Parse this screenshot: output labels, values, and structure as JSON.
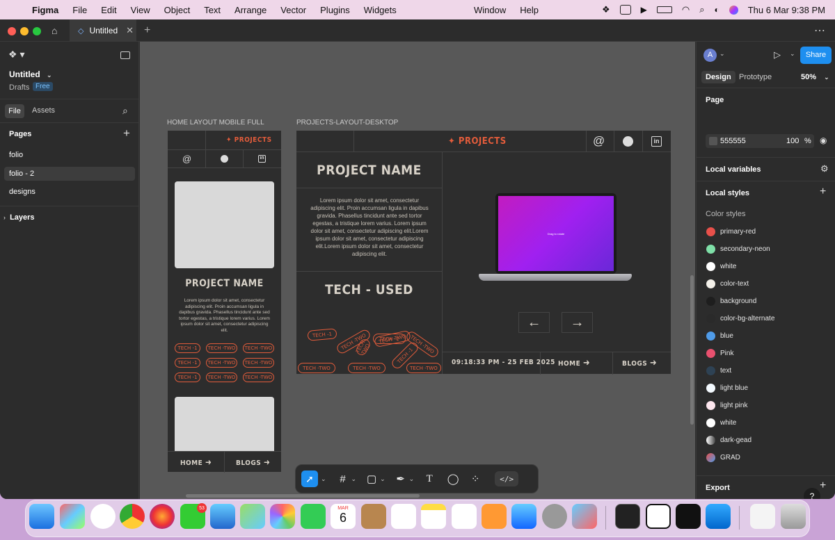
{
  "menubar": {
    "app_name": "Figma",
    "items": [
      "File",
      "Edit",
      "View",
      "Object",
      "Text",
      "Arrange",
      "Vector",
      "Plugins",
      "Widgets"
    ],
    "center_items": [
      "Window",
      "Help"
    ],
    "datetime": "Thu 6 Mar  9:38 PM"
  },
  "tab": {
    "title": "Untitled"
  },
  "left_panel": {
    "file_name": "Untitled",
    "location": "Drafts",
    "plan_badge": "Free",
    "tabs": [
      "File",
      "Assets"
    ],
    "pages_header": "Pages",
    "pages": [
      "folio",
      "folio - 2",
      "designs"
    ],
    "layers_header": "Layers"
  },
  "canvas": {
    "mobile_label": "HOME LAYOUT MOBILE FULL",
    "desktop_label": "PROJECTS-LAYOUT-DESKTOP",
    "projects_nav": "✦ PROJECTS",
    "project_name": "PROJECT NAME",
    "tech_used": "TECH - USED",
    "lorem_mobile": "Lorem ipsum dolor sit amet, consectetur adipiscing elit.  Proin accumsan ligula in dapibus gravida. Phasellus tincidunt ante sed tortor egestas, a tristique lorem varius. Lorem ipsum dolor sit amet, consectetur adipiscing elit.",
    "lorem_desktop": "Lorem ipsum dolor sit amet, consectetur adipiscing elit.  Proin accumsan ligula in dapibus gravida. Phasellus tincidunt ante sed tortor egestas, a tristique lorem varius. Lorem ipsum dolor sit amet, consectetur adipiscing elit.Lorem ipsum dolor sit amet, consectetur adipiscing elit.Lorem ipsum dolor sit amet, consectetur adipiscing elit.",
    "pill_one": "TECH -1",
    "pill_two": "TECH -TWO",
    "datetime_bar": "09:18:33 PM - 25 FEB 2025",
    "home_btn": "HOME",
    "blogs_btn": "BLOGS",
    "laptop_screen_text": "Drag to rotate",
    "at_symbol": "@",
    "linkedin_text": "in"
  },
  "right_panel": {
    "avatar": "A",
    "share": "Share",
    "tabs": [
      "Design",
      "Prototype"
    ],
    "zoom": "50%",
    "page_header": "Page",
    "page_color": "555555",
    "page_opacity": "100",
    "percent_sign": "%",
    "local_variables": "Local variables",
    "local_styles": "Local styles",
    "color_styles_header": "Color styles",
    "color_styles": [
      {
        "name": "primary-red",
        "color": "#e8504a"
      },
      {
        "name": "secondary-neon",
        "color": "#7fe0a8"
      },
      {
        "name": "white",
        "color": "#ffffff"
      },
      {
        "name": "color-text",
        "color": "#f4f1ea"
      },
      {
        "name": "background",
        "color": "#1e1e1e"
      },
      {
        "name": "color-bg-alternate",
        "color": "#2a2a2a"
      },
      {
        "name": "blue",
        "color": "#4f9be8"
      },
      {
        "name": "Pink",
        "color": "#e8506e"
      },
      {
        "name": "text",
        "color": "#2e4254"
      },
      {
        "name": "light blue",
        "color": "#f4faff"
      },
      {
        "name": "light pink",
        "color": "#fde6ee"
      },
      {
        "name": "white",
        "color": "#ffffff"
      },
      {
        "name": "dark-gead",
        "color": "#9a9a9a"
      },
      {
        "name": "GRAD",
        "color": "#e06a4a"
      }
    ],
    "export": "Export",
    "help": "?"
  },
  "dock": {
    "messages_badge": "53",
    "calendar_month": "MAR",
    "calendar_day": "6"
  },
  "colors": {
    "accent": "#e35c3b",
    "figma_blue": "#0d99ff"
  }
}
